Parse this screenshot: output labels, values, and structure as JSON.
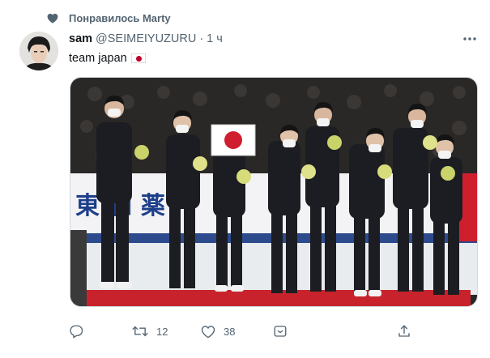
{
  "liked_by": {
    "text": "Понравилось Marty",
    "icon": "heart-filled-icon"
  },
  "tweet": {
    "author_name": "sam",
    "author_handle": "@SEIMEIYUZURU",
    "separator": "·",
    "time": "1 ч",
    "text": "team japan",
    "emoji": "japan-flag"
  },
  "media": {
    "banner_text": "東 和 薬",
    "accent_colors": {
      "carpet": "#c8232c",
      "uniform": "#1c1d22",
      "sign_red": "#cf1f2e"
    }
  },
  "actions": {
    "reply_icon": "reply-icon",
    "retweet_icon": "retweet-icon",
    "retweet_count": "12",
    "like_icon": "heart-outline-icon",
    "like_count": "38",
    "more_menu_icon": "chevron-menu-icon",
    "share_icon": "share-icon"
  },
  "colors": {
    "secondary_text": "#536471",
    "primary_text": "#0f1419",
    "border": "#cfd9de"
  }
}
